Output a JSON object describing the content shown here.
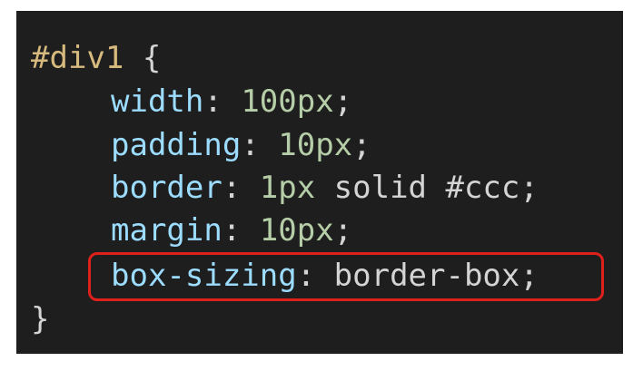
{
  "code": {
    "line1": {
      "selector": "#div1",
      "brace": " {"
    },
    "line2": {
      "property": "width",
      "colon": ": ",
      "value": "100px",
      "semi": ";"
    },
    "line3": {
      "property": "padding",
      "colon": ": ",
      "value": "10px",
      "semi": ";"
    },
    "line4": {
      "property": "border",
      "colon": ": ",
      "value_num": "1px",
      "value_rest": " solid #ccc",
      "semi": ";"
    },
    "line5": {
      "property": "margin",
      "colon": ": ",
      "value": "10px",
      "semi": ";"
    },
    "line6": {
      "property": "box-sizing",
      "colon": ": ",
      "value": "border-box",
      "semi": ";"
    },
    "line7": {
      "brace": "}"
    }
  },
  "colors": {
    "background": "#1e1e1e",
    "selector": "#d7ba7d",
    "property": "#9cdcfe",
    "number": "#b5cea8",
    "text": "#d4d4d4",
    "highlight": "#e0201b"
  }
}
